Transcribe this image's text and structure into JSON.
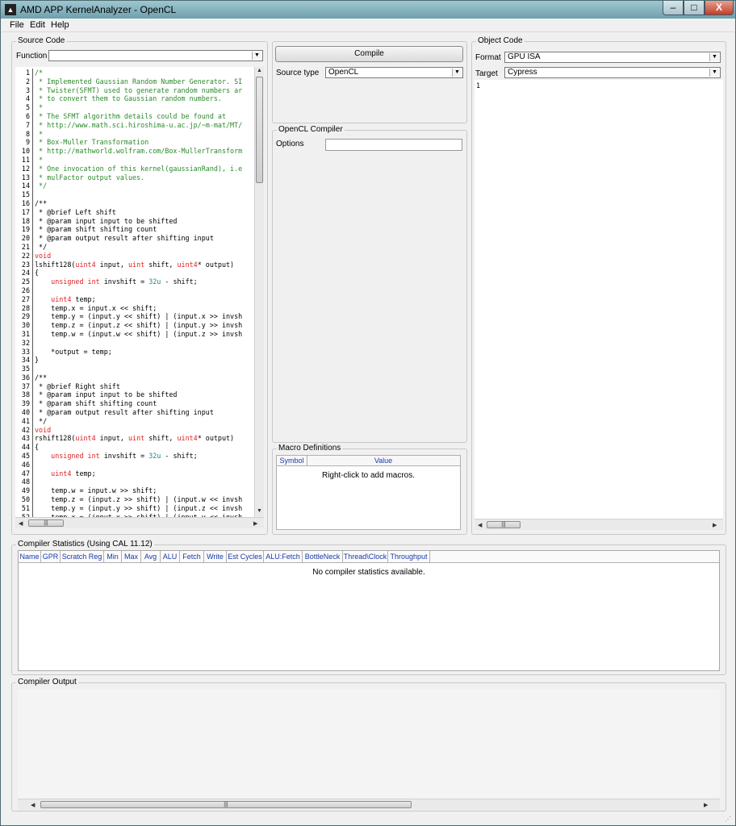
{
  "window": {
    "title": "AMD APP KernelAnalyzer - OpenCL",
    "icon": "amd-logo-icon",
    "minimize": "–",
    "maximize": "□",
    "close": "X"
  },
  "menu": {
    "file": "File",
    "edit": "Edit",
    "help": "Help"
  },
  "source": {
    "group_label": "Source Code",
    "function_label": "Function",
    "function_value": "",
    "line_numbers": [
      "1",
      "2",
      "3",
      "4",
      "5",
      "6",
      "7",
      "8",
      "9",
      "10",
      "11",
      "12",
      "13",
      "14",
      "15",
      "16",
      "17",
      "18",
      "19",
      "20",
      "21",
      "22",
      "23",
      "24",
      "25",
      "26",
      "27",
      "28",
      "29",
      "30",
      "31",
      "32",
      "33",
      "34",
      "35",
      "36",
      "37",
      "38",
      "39",
      "40",
      "41",
      "42",
      "43",
      "44",
      "45",
      "46",
      "47",
      "48",
      "49",
      "50",
      "51",
      "52"
    ]
  },
  "compile": {
    "button": "Compile",
    "source_type_label": "Source type",
    "source_type_value": "OpenCL"
  },
  "compiler": {
    "group_label": "OpenCL Compiler",
    "options_label": "Options",
    "options_value": ""
  },
  "macros": {
    "group_label": "Macro Definitions",
    "col_symbol": "Symbol",
    "col_value": "Value",
    "empty_text": "Right-click to add macros."
  },
  "object": {
    "group_label": "Object Code",
    "format_label": "Format",
    "format_value": "GPU ISA",
    "target_label": "Target",
    "target_value": "Cypress",
    "first_line": "1"
  },
  "stats": {
    "group_label": "Compiler Statistics (Using CAL 11.12)",
    "columns": [
      "Name",
      "GPR",
      "Scratch Reg",
      "Min",
      "Max",
      "Avg",
      "ALU",
      "Fetch",
      "Write",
      "Est Cycles",
      "ALU:Fetch",
      "BottleNeck",
      "Thread\\Clock",
      "Throughput"
    ],
    "empty_text": "No compiler statistics available."
  },
  "output": {
    "group_label": "Compiler Output"
  },
  "colors": {
    "comment": "#2a8a2a",
    "keyword": "#e02020",
    "literal": "#1a8a8a",
    "header_text": "#1a3aa8"
  }
}
